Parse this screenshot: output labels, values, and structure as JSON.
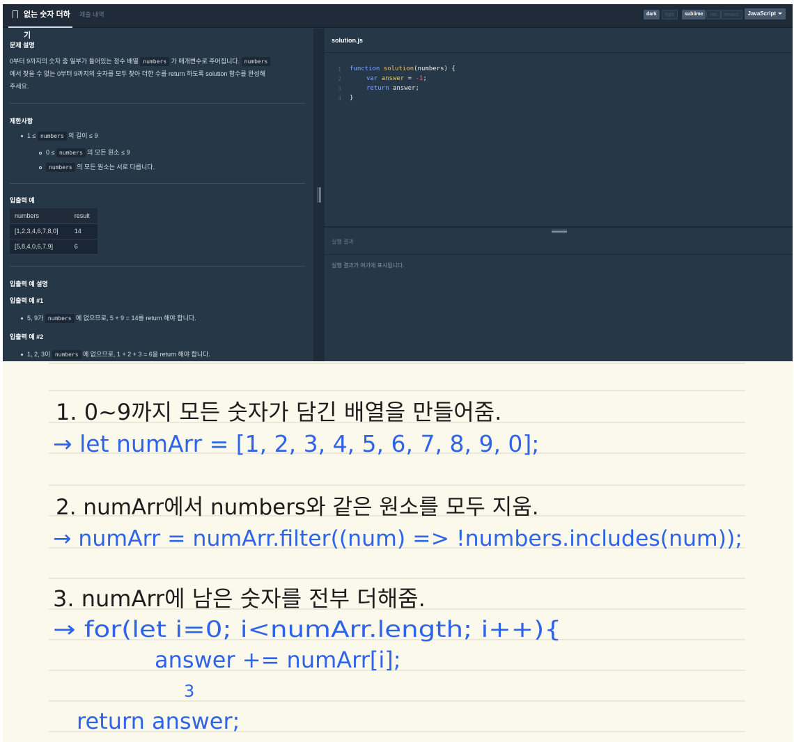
{
  "header": {
    "tabs": [
      {
        "label": "없는 숫자 더하기",
        "active": true
      },
      {
        "label": "제출 내역",
        "active": false
      }
    ],
    "theme_toggles": [
      {
        "label": "dark",
        "active": true
      },
      {
        "label": "light",
        "active": false
      }
    ],
    "keymap_toggles": [
      {
        "label": "sublime",
        "active": true
      },
      {
        "label": "vim",
        "active": false
      },
      {
        "label": "emacs",
        "active": false
      }
    ],
    "language": "JavaScript"
  },
  "problem": {
    "description_title": "문제 설명",
    "description": {
      "part1": "0부터 9까지의 숫자 중 일부가 들어있는 정수 배열 ",
      "code1": "numbers",
      "part2": " 가 매개변수로 주어집니다. ",
      "code2": "numbers",
      "part3": "에서 찾을 수 없는 0부터 9까지의 숫자를 모두 찾아 더한 수를 return 하도록 solution 함수를 완성해",
      "part4": "주세요."
    },
    "constraints_title": "제한사항",
    "constraints": [
      {
        "prefix": "1 ≤ ",
        "code": "numbers",
        "suffix": " 의 길이 ≤ 9"
      },
      {
        "prefix": "0 ≤ ",
        "code": "numbers",
        "suffix": " 의 모든 원소 ≤ 9"
      },
      {
        "prefix": "",
        "code": "numbers",
        "suffix": " 의 모든 원소는 서로 다릅니다."
      }
    ],
    "examples_title": "입출력 예",
    "table": {
      "headers": [
        "numbers",
        "result"
      ],
      "rows": [
        [
          "[1,2,3,4,6,7,8,0]",
          "14"
        ],
        [
          "[5,8,4,0,6,7,9]",
          "6"
        ]
      ]
    },
    "explanation_title": "입출력 예 설명",
    "explanations": [
      {
        "title": "입출력 예 #1",
        "prefix": "5, 9가 ",
        "code": "numbers",
        "suffix": " 에 없으므로, 5 + 9 = 14를 return 해야 합니다."
      },
      {
        "title": "입출력 예 #2",
        "prefix": "1, 2, 3이 ",
        "code": "numbers",
        "suffix": " 에 없으므로, 1 + 2 + 3 = 6을 return 해야 합니다."
      }
    ]
  },
  "editor": {
    "filename": "solution.js",
    "line_numbers": [
      "1",
      "2",
      "3",
      "4"
    ],
    "code": {
      "l1_kw": "function",
      "l1_fn": "solution",
      "l1_param": "(numbers) {",
      "l2_kw": "var",
      "l2_var": "answer",
      "l2_eq": " = ",
      "l2_num": "-1",
      "l2_end": ";",
      "l3_kw": "return",
      "l3_rest": " answer;",
      "l4": "}"
    }
  },
  "result": {
    "label": "실행 결과",
    "placeholder": "실행 결과가 여기에 표시됩니다."
  },
  "notes": {
    "lines": [
      "1. 0~9까지 모든 숫자가 담긴 배열을 만들어줌.",
      "→ let numArr = [1, 2, 3, 4, 5, 6, 7, 8, 9, 0];",
      "2. numArr에서 numbers와 같은 원소를 모두 지움.",
      "→ numArr = numArr.filter((num) => !numbers.includes(num));",
      "3. numArr에 남은 숫자를 전부 더해줌.",
      "→ for(let i=0; i<numArr.length; i++){",
      "answer += numArr[i];",
      "3",
      "return answer;"
    ],
    "ink_colors": {
      "black": "#1d1d1d",
      "blue": "#2f64e8"
    }
  }
}
